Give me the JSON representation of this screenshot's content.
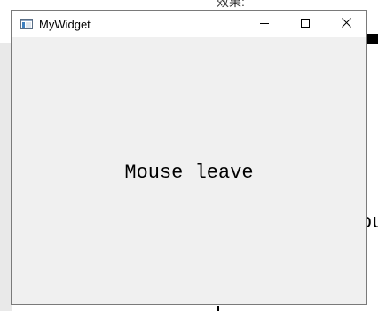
{
  "window": {
    "title": "MyWidget",
    "icon": "app-window-icon",
    "controls": {
      "minimize_icon": "minimize-icon",
      "maximize_icon": "maximize-icon",
      "close_icon": "close-icon"
    }
  },
  "content": {
    "status_text": "Mouse leave"
  },
  "background": {
    "top_text": "效果:",
    "right_text": "ou"
  },
  "colors": {
    "client_background": "#f0f0f0",
    "titlebar_background": "#ffffff",
    "text": "#000000"
  }
}
